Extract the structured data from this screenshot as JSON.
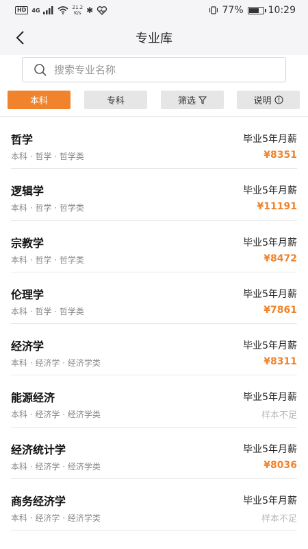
{
  "status_bar": {
    "badge": "HD",
    "network": "4G",
    "speed_top": "21.2",
    "speed_bottom": "K/s",
    "battery_text": "77%",
    "battery_level": 0.77,
    "time": "10:29"
  },
  "header": {
    "title": "专业库"
  },
  "search": {
    "placeholder": "搜索专业名称",
    "value": ""
  },
  "filters": {
    "tab_undergrad": "本科",
    "tab_junior": "专科",
    "filter_label": "筛选",
    "info_label": "说明"
  },
  "majors": [
    {
      "name": "哲学",
      "meta": "本科 · 哲学 · 哲学类",
      "salary_label": "毕业5年月薪",
      "salary": "¥8351"
    },
    {
      "name": "逻辑学",
      "meta": "本科 · 哲学 · 哲学类",
      "salary_label": "毕业5年月薪",
      "salary": "¥11191"
    },
    {
      "name": "宗教学",
      "meta": "本科 · 哲学 · 哲学类",
      "salary_label": "毕业5年月薪",
      "salary": "¥8472"
    },
    {
      "name": "伦理学",
      "meta": "本科 · 哲学 · 哲学类",
      "salary_label": "毕业5年月薪",
      "salary": "¥7861"
    },
    {
      "name": "经济学",
      "meta": "本科 · 经济学 · 经济学类",
      "salary_label": "毕业5年月薪",
      "salary": "¥8311"
    },
    {
      "name": "能源经济",
      "meta": "本科 · 经济学 · 经济学类",
      "salary_label": "毕业5年月薪",
      "salary": "样本不足"
    },
    {
      "name": "经济统计学",
      "meta": "本科 · 经济学 · 经济学类",
      "salary_label": "毕业5年月薪",
      "salary": "¥8036"
    },
    {
      "name": "商务经济学",
      "meta": "本科 · 经济学 · 经济学类",
      "salary_label": "毕业5年月薪",
      "salary": "样本不足"
    }
  ],
  "colors": {
    "accent": "#f0832b",
    "muted": "#b8b8b8"
  }
}
